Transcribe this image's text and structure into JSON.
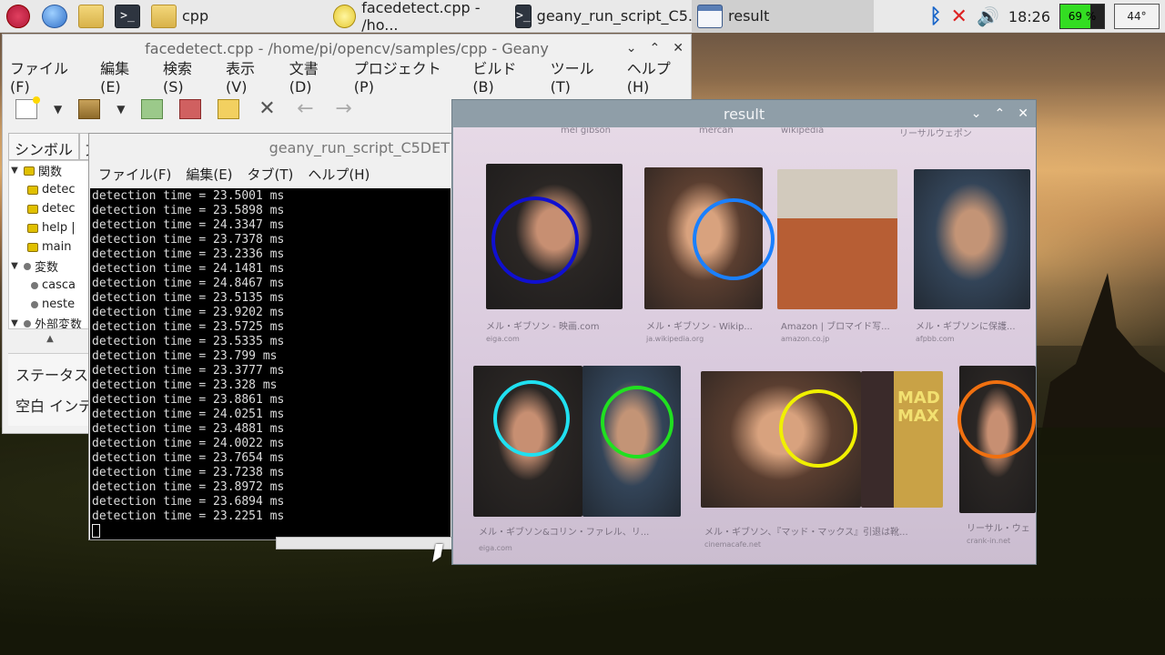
{
  "panel": {
    "tasks": [
      {
        "label": "cpp",
        "icon": "folder-icon"
      },
      {
        "label": "facedetect.cpp - /ho...",
        "icon": "geany-icon"
      },
      {
        "label": "geany_run_script_C5...",
        "icon": "terminal-icon"
      },
      {
        "label": "result",
        "icon": "window-icon"
      }
    ],
    "cpu": "69 %",
    "cpu_fraction": 0.69,
    "temperature": "44°",
    "clock": "18:26"
  },
  "geany": {
    "title": "facedetect.cpp - /home/pi/opencv/samples/cpp - Geany",
    "menu": [
      "ファイル(F)",
      "編集(E)",
      "検索(S)",
      "表示(V)",
      "文書(D)",
      "プロジェクト(P)",
      "ビルド(B)",
      "ツール(T)",
      "ヘルプ(H)"
    ],
    "sidebar_tab": "シンボル",
    "sidebar_tab2": "文",
    "tree": {
      "functions_label": "関数",
      "functions": [
        "detec",
        "detec",
        "help |",
        "main"
      ],
      "variables_label": "変数",
      "variables": [
        "casca",
        "neste"
      ],
      "external_label": "外部変数"
    },
    "status_label": "ステータス",
    "indent_label": "空白 インデ"
  },
  "terminal": {
    "title": "geany_run_script_C5DET",
    "menu": [
      "ファイル(F)",
      "編集(E)",
      "タブ(T)",
      "ヘルプ(H)"
    ],
    "lines": [
      "detection time = 23.5001 ms",
      "detection time = 23.5898 ms",
      "detection time = 24.3347 ms",
      "detection time = 23.7378 ms",
      "detection time = 23.2336 ms",
      "detection time = 24.1481 ms",
      "detection time = 24.8467 ms",
      "detection time = 23.5135 ms",
      "detection time = 23.9202 ms",
      "detection time = 23.5725 ms",
      "detection time = 23.5335 ms",
      "detection time = 23.799 ms",
      "detection time = 23.3777 ms",
      "detection time = 23.328 ms",
      "detection time = 23.8861 ms",
      "detection time = 24.0251 ms",
      "detection time = 23.4881 ms",
      "detection time = 24.0022 ms",
      "detection time = 23.7654 ms",
      "detection time = 23.7238 ms",
      "detection time = 23.8972 ms",
      "detection time = 23.6894 ms",
      "detection time = 23.2251 ms"
    ]
  },
  "result": {
    "title": "result",
    "top_chips": [
      "mel gibson",
      "mercan",
      "wikipedia",
      "リーサルウェポン"
    ],
    "captions_row1": [
      {
        "title": "メル・ギブソン - 映画.com",
        "src": "eiga.com"
      },
      {
        "title": "メル・ギブソン - Wikip...",
        "src": "ja.wikipedia.org"
      },
      {
        "title": "Amazon | ブロマイド写...",
        "src": "amazon.co.jp"
      },
      {
        "title": "メル・ギブソンに保護...",
        "src": "afpbb.com"
      }
    ],
    "captions_row2": [
      {
        "title": "メル・ギブソン&コリン・ファレル、リ...",
        "src": "eiga.com"
      },
      {
        "title": "メル・ギブソン、『マッド・マックス』引退は靴...",
        "src": "cinemacafe.net"
      },
      {
        "title": "リーサル・ウェ",
        "src": "crank-in.net"
      }
    ],
    "poster_text": "MAD MAX",
    "face_colors": [
      "#1010d0",
      "#1a80ff",
      "#20e0f0",
      "#20e020",
      "#f0f000",
      "#f07010"
    ]
  }
}
